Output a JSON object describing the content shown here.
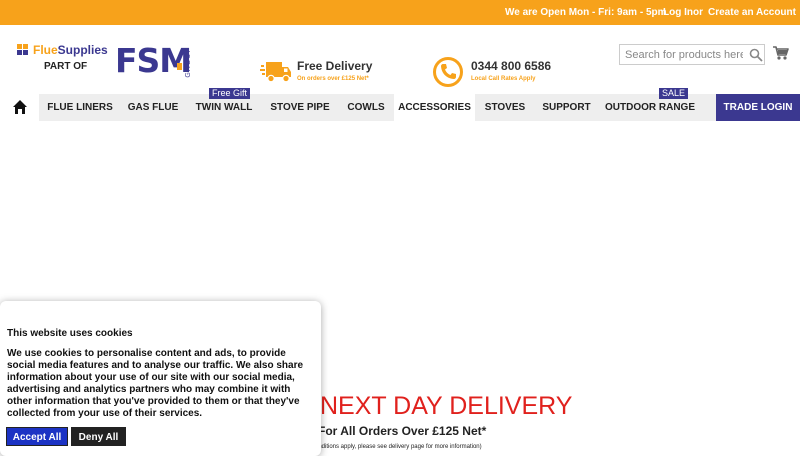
{
  "topbar": {
    "hours": "We are Open Mon - Fri: 9am - 5pm",
    "login": "Log In",
    "or": "or",
    "create": "Create an Account"
  },
  "brand": {
    "flue": "Flue",
    "supplies": "Supplies",
    "part_of": "PART OF",
    "fsm": "FSM",
    "group": "GROUP"
  },
  "delivery": {
    "title": "Free Delivery",
    "sub": "On orders over £125 Net*"
  },
  "phone": {
    "number": "0344 800 6586",
    "sub": "Local Call Rates Apply"
  },
  "search": {
    "placeholder": "Search for products here"
  },
  "nav": {
    "items": [
      {
        "label": "FLUE LINERS"
      },
      {
        "label": "GAS FLUE"
      },
      {
        "label": "TWIN WALL"
      },
      {
        "label": "STOVE PIPE"
      },
      {
        "label": "COWLS"
      },
      {
        "label": "ACCESSORIES"
      },
      {
        "label": "STOVES"
      },
      {
        "label": "SUPPORT"
      },
      {
        "label": "OUTDOOR RANGE"
      }
    ],
    "free_gift_badge": "Free Gift",
    "sale_badge": "SALE",
    "trade_login": "TRADE LOGIN"
  },
  "hero": {
    "title": "NEXT DAY DELIVERY",
    "subtitle": "For All Orders Over £125 Net*",
    "note": "(conditions apply, please see delivery page for more information)"
  },
  "cookie": {
    "title": "This website uses cookies",
    "body": "We use cookies to personalise content and ads, to provide social media features and to analyse our traffic. We also share information about your use of our site with our social media, advertising and analytics partners who may combine it with other information that you've provided to them or that they've collected from your use of their services.",
    "accept": "Accept All",
    "deny": "Deny All"
  },
  "colors": {
    "orange": "#f7a21b",
    "purple": "#3b3890",
    "red": "#e0211d",
    "accept_blue": "#1c33c4"
  }
}
